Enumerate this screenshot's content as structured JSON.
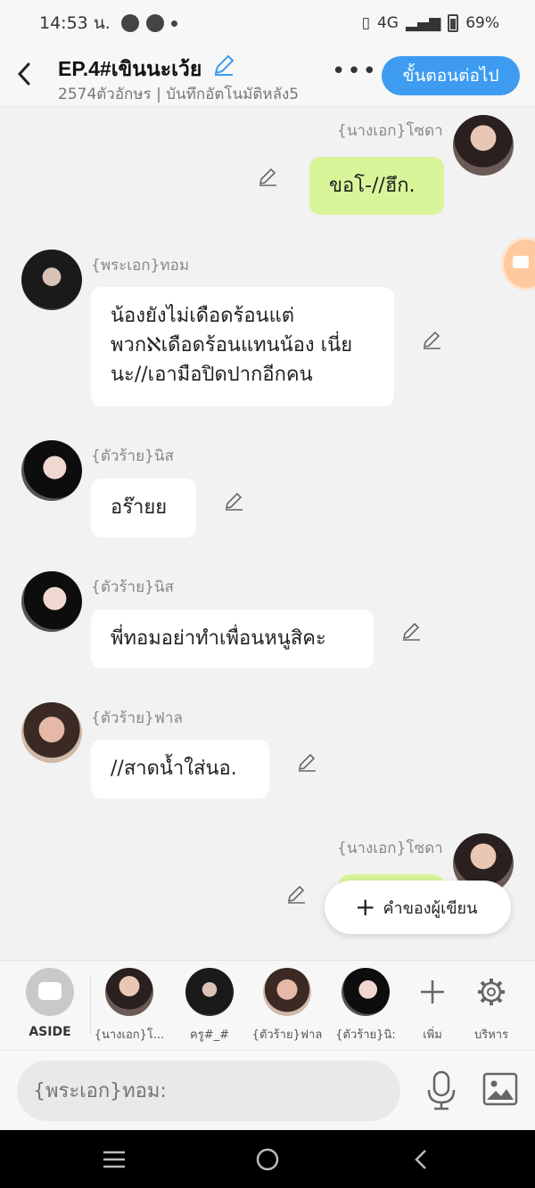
{
  "status_bar": {
    "time": "14:53 น.",
    "network": "4G",
    "battery": "69%"
  },
  "header": {
    "title": "EP.4#เขินนะเว้ย",
    "subtitle": "2574ตัวอักษร | บันทึกอัตโนมัติหลัง5",
    "more": "•••",
    "next_button": "ขั้นตอนต่อไป"
  },
  "messages": [
    {
      "sender": "{นางเอก}โซดา",
      "text": "ขอโ-//ฮึก.",
      "mine": true
    },
    {
      "sender": "{พระเอก}ทอม",
      "text": "น้องยังไม่เดือดร้อนแต่ พวกℵเดือดร้อนแทนน้อง เนี่ยนะ//เอามือปิดปากอีกคน",
      "mine": false
    },
    {
      "sender": "{ตัวร้าย}นิส",
      "text": "อร๊ายย",
      "mine": false
    },
    {
      "sender": "{ตัวร้าย}นิส",
      "text": "พี่ทอมอย่าทำเพื่อนหนูสิคะ",
      "mine": false
    },
    {
      "sender": "{ตัวร้าย}ฟาล",
      "text": "//สาดน้ำใส่นอ.",
      "mine": false
    },
    {
      "sender": "{นางเอก}โซดา",
      "text": "",
      "mine": true
    }
  ],
  "writer_button": {
    "label": "คำของผู้เขียน",
    "icon": "plus-icon"
  },
  "cast_bar": {
    "aside_label": "ASIDE",
    "characters": [
      "{นางเอก}โ...",
      "ครู#_#",
      "{ตัวร้าย}ฟาล",
      "{ตัวร้าย}นิ:"
    ],
    "add_label": "เพิ่ม",
    "manage_label": "บริหาร"
  },
  "input": {
    "placeholder": "{พระเอก}ทอม:"
  },
  "colors": {
    "accent": "#3d9cf0",
    "mine_bubble": "#d8f59a",
    "background": "#f2f2f2"
  }
}
